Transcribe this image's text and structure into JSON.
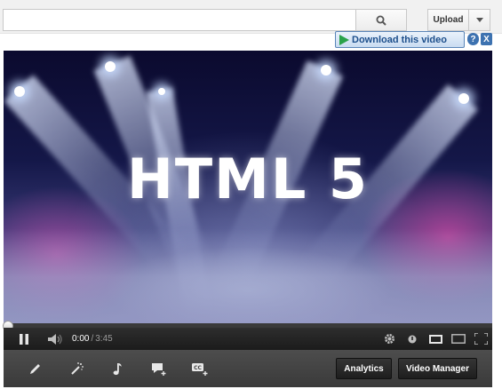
{
  "search": {
    "value": "",
    "placeholder": "",
    "button_icon": "search-icon"
  },
  "upload": {
    "label": "Upload",
    "menu_icon": "caret-down-icon"
  },
  "download_bar": {
    "label": "Download this video",
    "help_label": "?",
    "close_label": "X",
    "accent": "#2aa24a"
  },
  "video": {
    "title_text": "HTML 5"
  },
  "player": {
    "current_time": "0:00",
    "separator": "/",
    "duration": "3:45",
    "progress_fraction": 0.0,
    "controls": [
      "pause-icon",
      "volume-icon",
      "gear-icon",
      "quality-icon",
      "small-player-icon",
      "large-player-icon",
      "fullscreen-icon"
    ]
  },
  "toolbar": {
    "tools": [
      "pencil-icon",
      "magic-wand-icon",
      "music-note-icon",
      "annotation-add-icon",
      "captions-add-icon"
    ],
    "analytics_label": "Analytics",
    "video_manager_label": "Video Manager"
  }
}
